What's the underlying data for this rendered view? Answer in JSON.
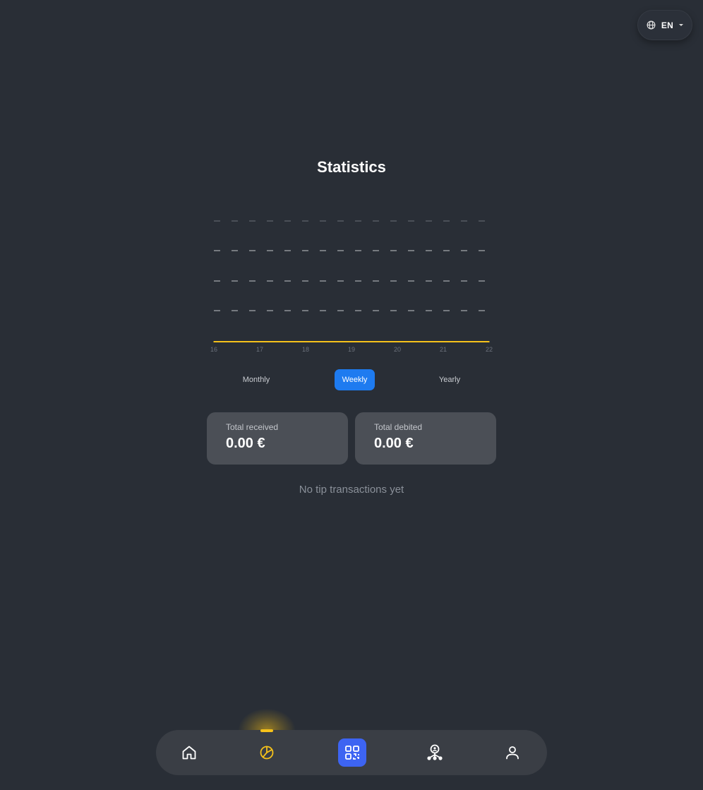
{
  "language": {
    "current": "EN",
    "icon": "globe-icon"
  },
  "page": {
    "title": "Statistics"
  },
  "chart_data": {
    "type": "line",
    "x": [
      "16",
      "17",
      "18",
      "19",
      "20",
      "21",
      "22"
    ],
    "series": [
      {
        "values": [
          0,
          0,
          0,
          0,
          0,
          0,
          0
        ],
        "color": "#f6c21a"
      }
    ],
    "grid": true,
    "grid_style": "dashed"
  },
  "period": {
    "tabs": [
      "Monthly",
      "Weekly",
      "Yearly"
    ],
    "selected": "Weekly",
    "accent": "#1e7bf0"
  },
  "summary": {
    "received_label": "Total received",
    "received_value": "0.00 €",
    "debited_label": "Total debited",
    "debited_value": "0.00 €"
  },
  "empty_state": "No tip transactions yet",
  "nav": {
    "items": [
      {
        "icon": "home-icon",
        "active": false
      },
      {
        "icon": "pie-chart-icon",
        "active": true
      },
      {
        "icon": "qr-code-icon",
        "active": false
      },
      {
        "icon": "network-icon",
        "active": false
      },
      {
        "icon": "user-icon",
        "active": false
      }
    ],
    "active_color": "#f6c21a",
    "qr_button_color": "#3d64f2"
  }
}
